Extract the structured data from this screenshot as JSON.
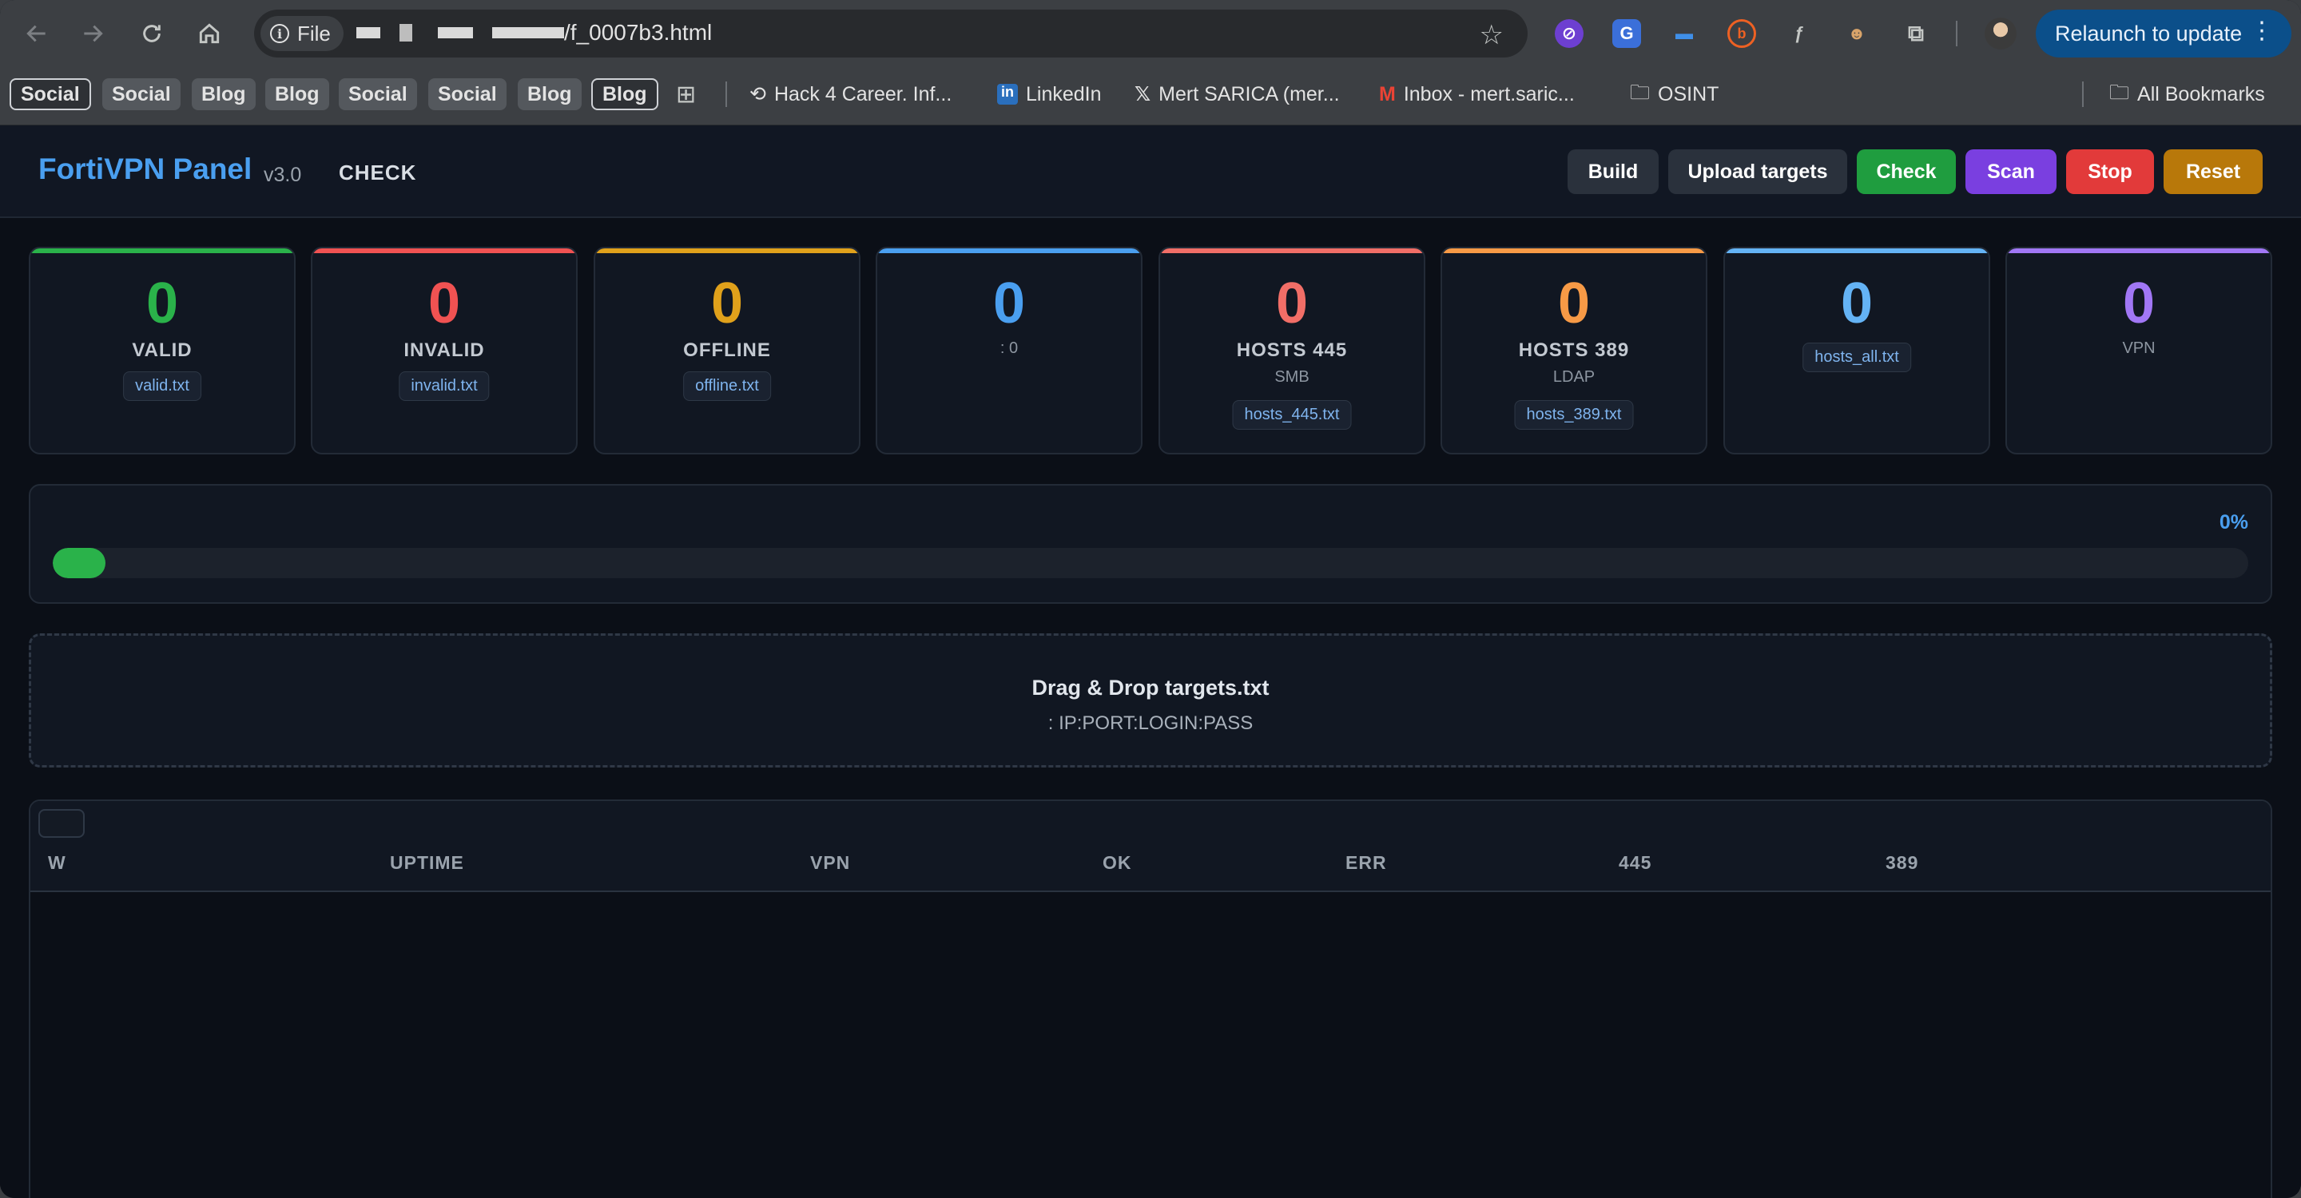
{
  "browser": {
    "address": {
      "scheme_label": "File",
      "url_suffix": "/f_0007b3.html"
    },
    "relaunch_label": "Relaunch to update",
    "extensions": [
      "block-icon",
      "translate-icon",
      "screen-icon",
      "bitly-icon",
      "feather-icon",
      "agent-icon",
      "puzzle-icon"
    ],
    "bookmarks": [
      {
        "label": "Social",
        "style": "outlined"
      },
      {
        "label": "Social",
        "style": "pill"
      },
      {
        "label": "Blog",
        "style": "pill"
      },
      {
        "label": "Blog",
        "style": "pill"
      },
      {
        "label": "Social",
        "style": "pill"
      },
      {
        "label": "Social",
        "style": "pill"
      },
      {
        "label": "Blog",
        "style": "pill"
      },
      {
        "label": "Blog",
        "style": "outlined"
      },
      {
        "label": "Hack 4 Career. Inf...",
        "style": "link"
      },
      {
        "label": "LinkedIn",
        "style": "link"
      },
      {
        "label": "Mert SARICA (mer...",
        "style": "link"
      },
      {
        "label": "Inbox - mert.saric...",
        "style": "link"
      },
      {
        "label": "OSINT",
        "style": "folder"
      },
      {
        "label": "All Bookmarks",
        "style": "folder"
      }
    ]
  },
  "app": {
    "brand": "FortiVPN Panel",
    "version": "v3.0",
    "mode": "CHECK",
    "buttons": {
      "build": "Build",
      "upload": "Upload targets",
      "check": "Check",
      "scan": "Scan",
      "stop": "Stop",
      "reset": "Reset"
    },
    "colors": {
      "green": "#2ab24a",
      "red": "#f05252",
      "amber": "#e0a11b",
      "blue": "#4a9ff0",
      "salmon": "#f16e67",
      "orange": "#f79a46",
      "sky": "#64b3f5",
      "purple": "#a177f5"
    },
    "cards": [
      {
        "value": "0",
        "label": "VALID",
        "sub": "",
        "file": "valid.txt"
      },
      {
        "value": "0",
        "label": "INVALID",
        "sub": "",
        "file": "invalid.txt"
      },
      {
        "value": "0",
        "label": "OFFLINE",
        "sub": "",
        "file": "offline.txt"
      },
      {
        "value": "0",
        "label": "",
        "sub": ": 0",
        "file": ""
      },
      {
        "value": "0",
        "label": "HOSTS 445",
        "sub": "SMB",
        "file": "hosts_445.txt"
      },
      {
        "value": "0",
        "label": "HOSTS 389",
        "sub": "LDAP",
        "file": "hosts_389.txt"
      },
      {
        "value": "0",
        "label": "",
        "sub": "",
        "file": "hosts_all.txt"
      },
      {
        "value": "0",
        "label": "",
        "sub": "VPN",
        "file": ""
      }
    ],
    "progress": {
      "percent_label": "0%",
      "fraction": 0
    },
    "dropzone": {
      "title": "Drag & Drop targets.txt",
      "subtitle": ": IP:PORT:LOGIN:PASS"
    },
    "table": {
      "columns": [
        "W",
        "UPTIME",
        "VPN",
        "OK",
        "ERR",
        "445",
        "389"
      ]
    }
  }
}
